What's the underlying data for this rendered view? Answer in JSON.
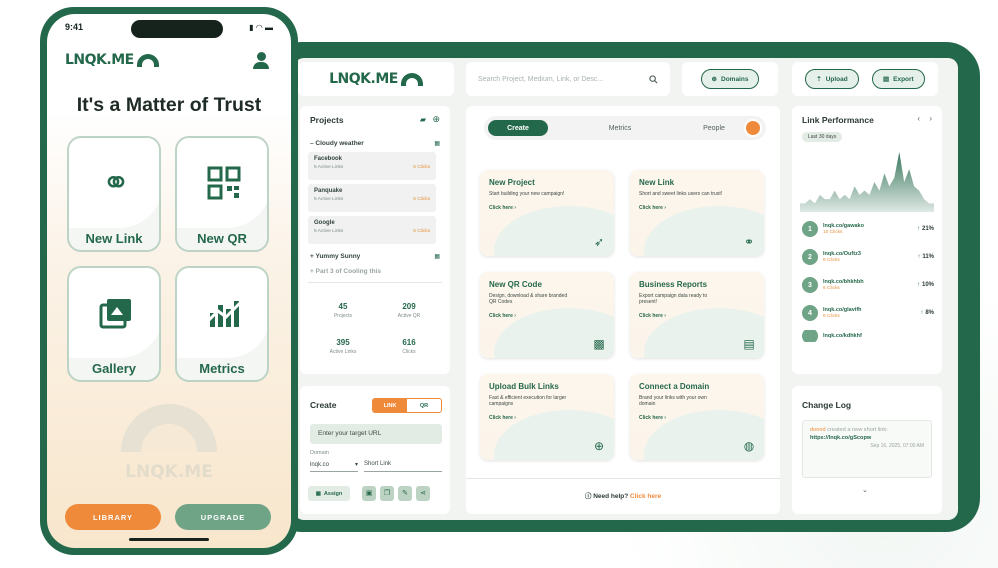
{
  "desktop": {
    "logo": "LNQK.ME",
    "search_placeholder": "Search Project, Medium, Link, or Desc...",
    "buttons": {
      "domains": "Domains",
      "upload": "Upload",
      "export": "Export"
    },
    "projects": {
      "title": "Projects",
      "group1": "Cloudy weather",
      "rows": [
        {
          "name": "Facebook",
          "links": "5 Active Links",
          "clicks": "5 Clicks"
        },
        {
          "name": "Panquake",
          "links": "5 Active Links",
          "clicks": "5 Clicks"
        },
        {
          "name": "Google",
          "links": "5 Active Links",
          "clicks": "5 Clicks"
        }
      ],
      "group2": "Yummy Sunny",
      "group3": "Part 3 of Cooling this",
      "stats": [
        {
          "value": "45",
          "label": "Projects"
        },
        {
          "value": "209",
          "label": "Active QR"
        },
        {
          "value": "395",
          "label": "Active Links"
        },
        {
          "value": "616",
          "label": "Clicks"
        }
      ]
    },
    "create": {
      "title": "Create",
      "toggle_link": "LINK",
      "toggle_qr": "QR",
      "target_placeholder": "Enter your target URL",
      "domain_label": "Domain",
      "domain_value": "lnqk.co",
      "short_placeholder": "Short Link",
      "assign": "Assign"
    },
    "tabs": {
      "create": "Create",
      "metrics": "Metrics",
      "people": "People"
    },
    "cards": [
      {
        "title": "New Project",
        "desc": "Start building your new campaign!",
        "cta": "Click here ›",
        "icon": "rocket-icon"
      },
      {
        "title": "New Link",
        "desc": "Short and sweet links users can trust!",
        "cta": "Click here ›",
        "icon": "link-icon"
      },
      {
        "title": "New QR Code",
        "desc": "Design, download & share branded QR Codes",
        "cta": "Click here ›",
        "icon": "qr-icon"
      },
      {
        "title": "Business Reports",
        "desc": "Export campaign data ready to present!",
        "cta": "Click here ›",
        "icon": "database-icon"
      },
      {
        "title": "Upload Bulk Links",
        "desc": "Fast & efficient execution for larger campaigns",
        "cta": "Click here ›",
        "icon": "upload-icon"
      },
      {
        "title": "Connect a Domain",
        "desc": "Brand your links with your own domain",
        "cta": "Click here ›",
        "icon": "globe-icon"
      }
    ],
    "help": {
      "text": "Need help?",
      "link": "Click here"
    },
    "performance": {
      "title": "Link Performance",
      "period": "Last 30 days",
      "spark": [
        2,
        2,
        3,
        2,
        4,
        3,
        3,
        5,
        3,
        4,
        3,
        6,
        4,
        5,
        4,
        7,
        5,
        9,
        6,
        8,
        14,
        7,
        10,
        6,
        5,
        3,
        2,
        2
      ],
      "items": [
        {
          "n": "1",
          "url": "lnqk.co/gawako",
          "clicks": "10 Clicks",
          "pct": "21%"
        },
        {
          "n": "2",
          "url": "lnqk.co/Ouftz3",
          "clicks": "8 Clicks",
          "pct": "11%"
        },
        {
          "n": "3",
          "url": "lnqk.co/bhkhbh",
          "clicks": "6 Clicks",
          "pct": "10%"
        },
        {
          "n": "4",
          "url": "lnqk.co/glavifh",
          "clicks": "6 Clicks",
          "pct": "8%"
        },
        {
          "n": "",
          "url": "lnqk.co/kdhkhf",
          "clicks": "",
          "pct": ""
        }
      ]
    },
    "changelog": {
      "title": "Change Log",
      "user": "doned",
      "action": " created a new short link:",
      "url": "https://lnqk.co/gScopw",
      "date": "Sep 16, 2025, 07:00 AM"
    }
  },
  "phone": {
    "time": "9:41",
    "logo": "LNQK.ME",
    "headline": "It's a Matter of Trust",
    "tiles": [
      "New Link",
      "New QR",
      "Gallery",
      "Metrics"
    ],
    "watermark": "LNQK.ME",
    "library": "LIBRARY",
    "upgrade": "UPGRADE"
  },
  "colors": {
    "brand": "#24684b",
    "accent": "#ef8a3b"
  }
}
